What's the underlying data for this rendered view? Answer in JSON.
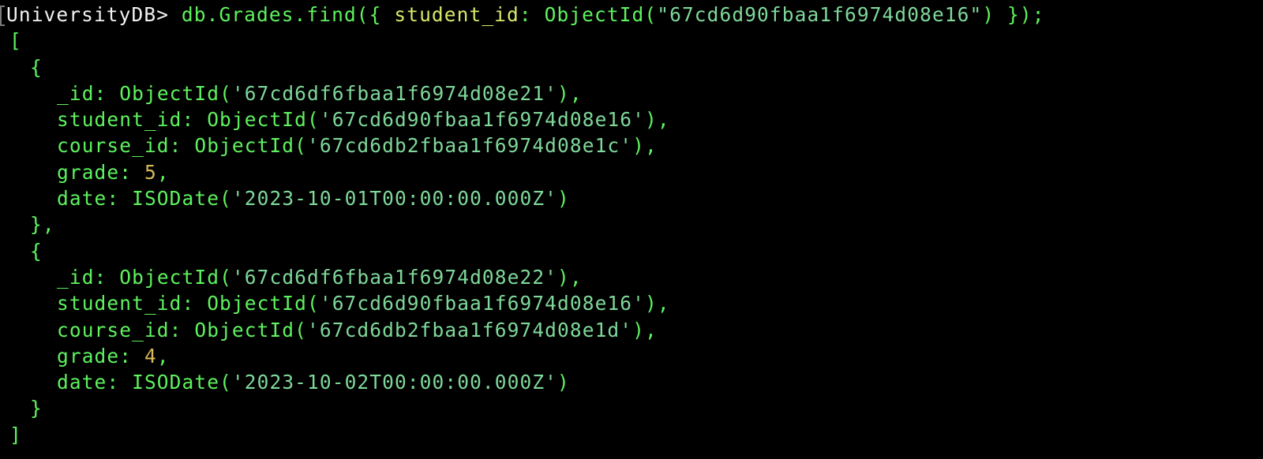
{
  "prompt": {
    "db_name": "UniversityDB",
    "symbol": "> ",
    "command_prefix": "db.Grades.find({ ",
    "filter_key": "student_id",
    "filter_sep": ": ",
    "filter_func": "ObjectId(",
    "filter_value": "\"67cd6d90fbaa1f6974d08e16\"",
    "command_suffix": ") });"
  },
  "brackets": {
    "open": "[",
    "close": "]",
    "obj_open": "{",
    "obj_close_comma": "},",
    "obj_close": "}"
  },
  "documents": [
    {
      "id_key": "_id: ",
      "id_func": "ObjectId(",
      "id_value": "'67cd6df6fbaa1f6974d08e21'",
      "id_end": "),",
      "student_key": "student_id: ",
      "student_func": "ObjectId(",
      "student_value": "'67cd6d90fbaa1f6974d08e16'",
      "student_end": "),",
      "course_key": "course_id: ",
      "course_func": "ObjectId(",
      "course_value": "'67cd6db2fbaa1f6974d08e1c'",
      "course_end": "),",
      "grade_key": "grade: ",
      "grade_value": "5",
      "grade_end": ",",
      "date_key": "date: ",
      "date_func": "ISODate(",
      "date_value": "'2023-10-01T00:00:00.000Z'",
      "date_end": ")"
    },
    {
      "id_key": "_id: ",
      "id_func": "ObjectId(",
      "id_value": "'67cd6df6fbaa1f6974d08e22'",
      "id_end": "),",
      "student_key": "student_id: ",
      "student_func": "ObjectId(",
      "student_value": "'67cd6d90fbaa1f6974d08e16'",
      "student_end": "),",
      "course_key": "course_id: ",
      "course_func": "ObjectId(",
      "course_value": "'67cd6db2fbaa1f6974d08e1d'",
      "course_end": "),",
      "grade_key": "grade: ",
      "grade_value": "4",
      "grade_end": ",",
      "date_key": "date: ",
      "date_func": "ISODate(",
      "date_value": "'2023-10-02T00:00:00.000Z'",
      "date_end": ")"
    }
  ],
  "colors": {
    "background": "#000000",
    "prompt_text": "#f2f2f2",
    "command_green": "#5ef25e",
    "query_key_yellow": "#d8e86a",
    "string_green": "#7fd89a",
    "number_gold": "#d8b85a"
  }
}
